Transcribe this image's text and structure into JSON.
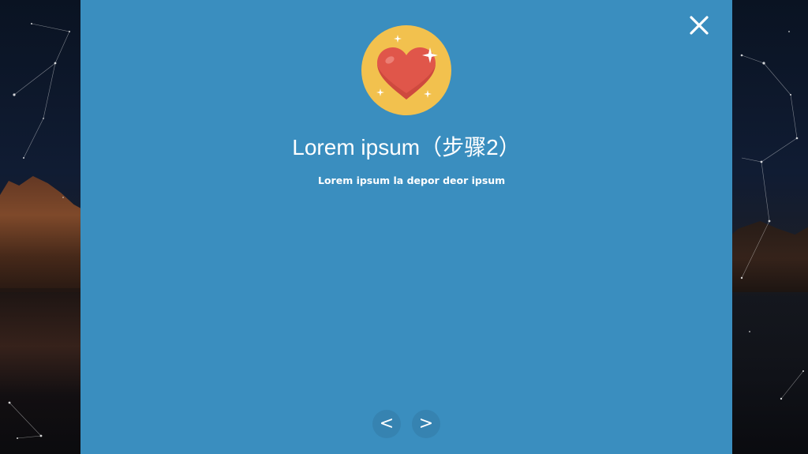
{
  "modal": {
    "title": "Lorem ipsum（步骤2）",
    "subtitle": "Lorem ipsum la depor deor ipsum",
    "icon": "heart-sparkle-icon",
    "background_color": "#3a8ebf",
    "icon_background_color": "#f2c14e",
    "heart_color": "#e0564a"
  },
  "controls": {
    "close_glyph": "×",
    "prev_glyph": "<",
    "next_glyph": ">"
  }
}
